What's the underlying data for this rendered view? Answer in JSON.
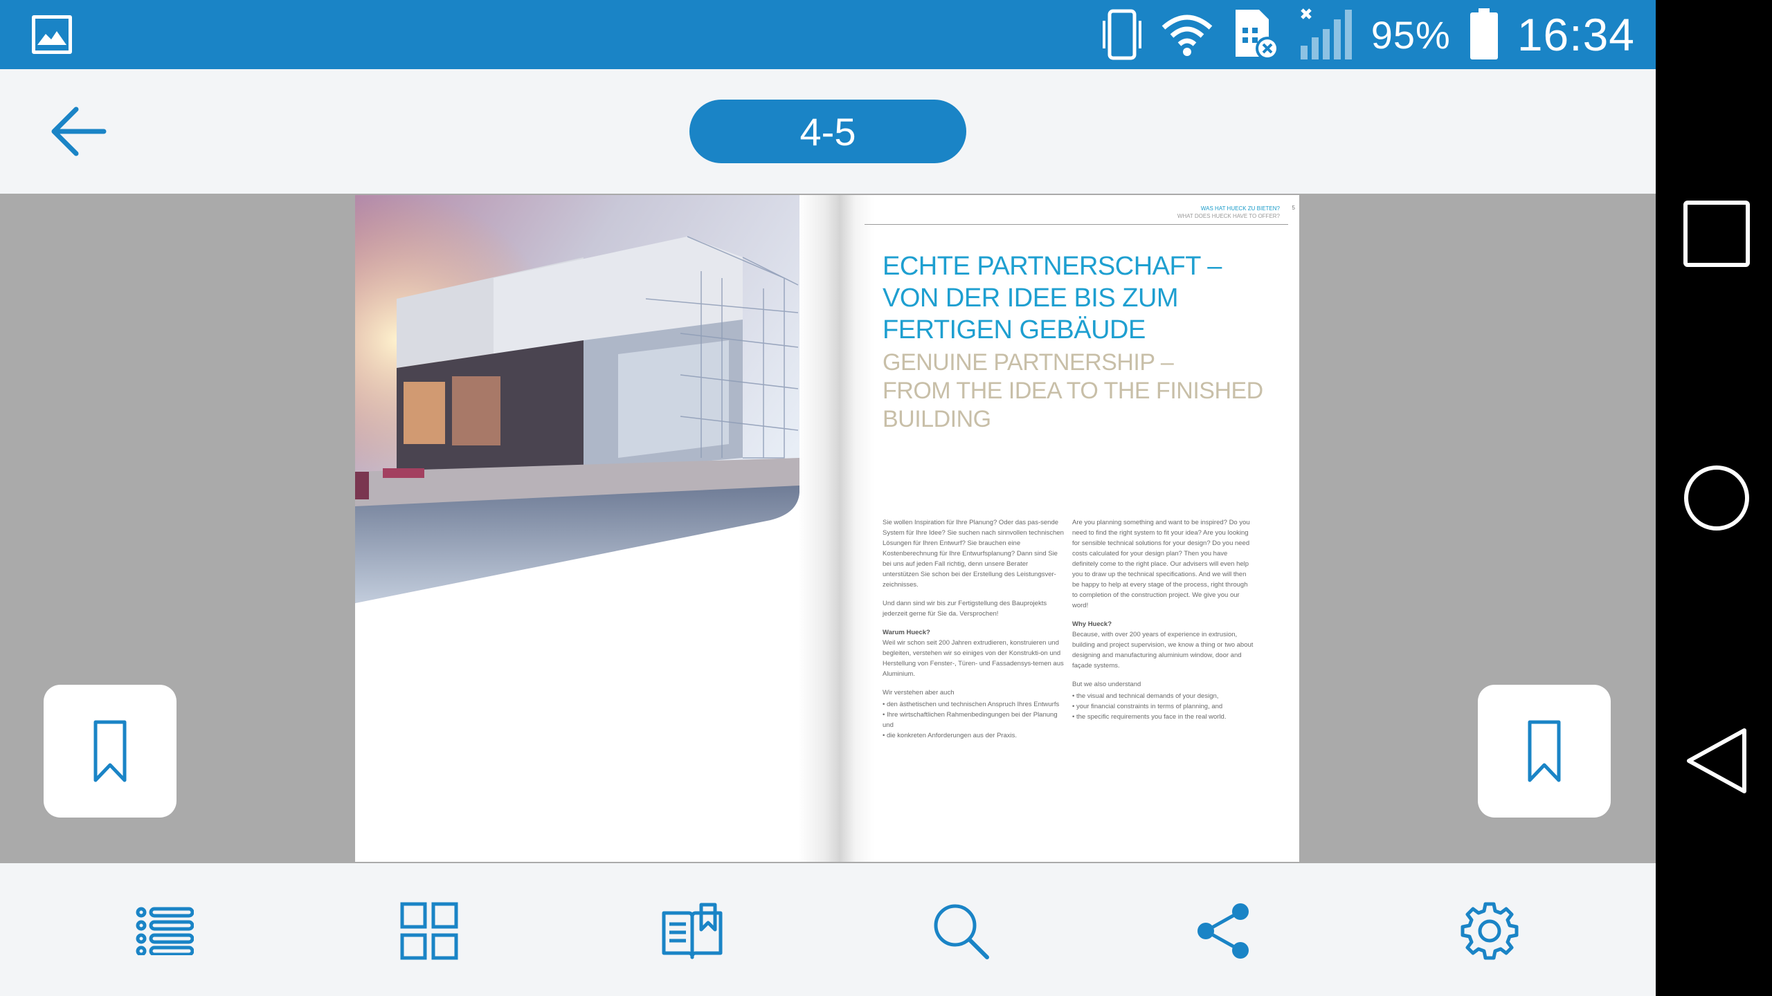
{
  "status_bar": {
    "battery_percent": "95%",
    "time": "16:34",
    "icons": [
      "gallery-icon",
      "vibrate-icon",
      "wifi-icon",
      "sim-error-icon",
      "signal-icon",
      "battery-icon"
    ]
  },
  "header": {
    "page_indicator": "4-5"
  },
  "document": {
    "running_head": {
      "title": "WAS HAT HUECK ZU BIETEN?",
      "subtitle": "WHAT DOES HUECK HAVE TO OFFER?",
      "page_number": "5"
    },
    "heading_de": [
      "ECHTE PARTNERSCHAFT –",
      "VON DER IDEE BIS ZUM",
      "FERTIGEN GEBÄUDE"
    ],
    "heading_en": [
      "GENUINE PARTNERSHIP –",
      "FROM THE IDEA TO THE FINISHED",
      "BUILDING"
    ],
    "column_de": {
      "p1": "Sie wollen Inspiration für Ihre Planung? Oder das pas-sende System für Ihre Idee? Sie suchen nach sinnvollen technischen Lösungen für Ihren Entwurf? Sie brauchen eine Kostenberechnung für Ihre Entwurfsplanung? Dann sind Sie bei uns auf jeden Fall richtig, denn unsere Berater unterstützen Sie schon bei der Erstellung des Leistungsver-zeichnisses.",
      "p2": "Und dann sind wir bis zur Fertigstellung des Bauprojekts jederzeit gerne für Sie da. Versprochen!",
      "h3": "Warum Hueck?",
      "p3": "Weil wir schon seit 200 Jahren extrudieren, konstruieren und begleiten, verstehen wir so einiges von der Konstrukti-on und Herstellung von Fenster-, Türen- und Fassadensys-temen aus Aluminium.",
      "p4": "Wir verstehen aber auch",
      "list": [
        "den ästhetischen und technischen Anspruch Ihres Entwurfs",
        "Ihre wirtschaftlichen Rahmenbedingungen bei der Planung und",
        "die konkreten Anforderungen aus der Praxis."
      ]
    },
    "column_en": {
      "p1": "Are you planning something and want to be inspired? Do you need to find the right system to fit your idea? Are you looking for sensible technical solutions for your design? Do you need costs calculated for your design plan? Then you have definitely come to the right place. Our advisers will even help you to draw up the technical specifications. And we will then be happy to help at every stage of the process, right through to completion of the construction project. We give you our word!",
      "h3": "Why Hueck?",
      "p3": "Because, with over 200 years of experience in extrusion, building and project supervision, we know a thing or two about designing and manufacturing aluminium window, door and façade systems.",
      "p4": "But we also understand",
      "list": [
        "the visual and technical demands of your design,",
        "your financial constraints in terms of planning, and",
        "the specific requirements you face in the real world."
      ]
    }
  },
  "toolbar": {
    "items": [
      "list-icon",
      "grid-icon",
      "book-bookmark-icon",
      "search-icon",
      "share-icon",
      "settings-icon"
    ]
  },
  "colors": {
    "accent": "#1a84c6",
    "heading_de": "#1e9fd0",
    "heading_en": "#c8bfa8",
    "viewer_bg": "#aaaaaa"
  }
}
